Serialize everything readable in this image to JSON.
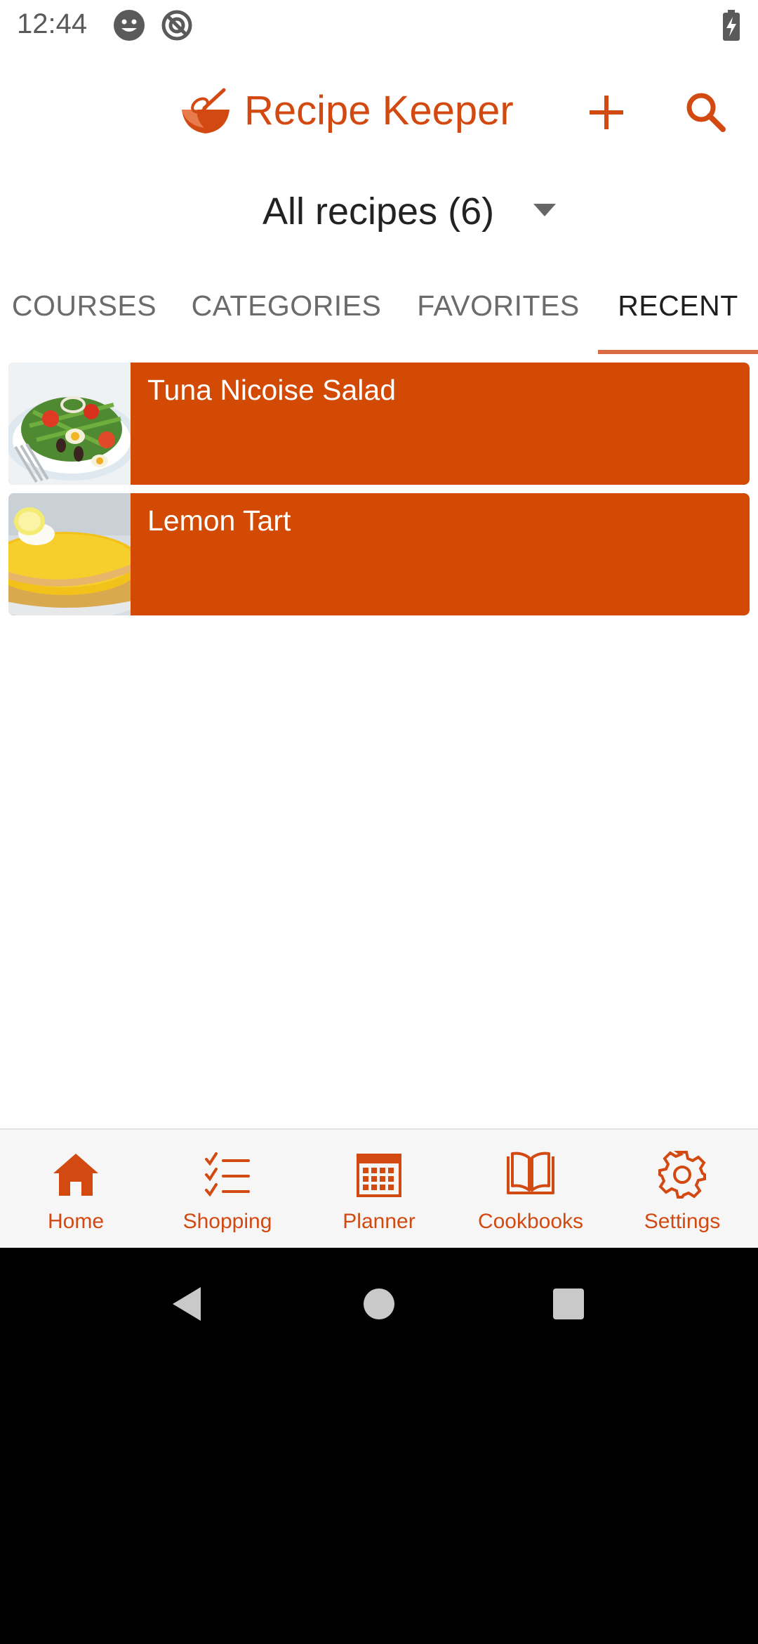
{
  "status_bar": {
    "time": "12:44"
  },
  "app_bar": {
    "title": "Recipe Keeper"
  },
  "filter": {
    "label": "All recipes (6)"
  },
  "tabs": [
    {
      "label": "COURSES"
    },
    {
      "label": "CATEGORIES"
    },
    {
      "label": "FAVORITES"
    },
    {
      "label": "RECENT",
      "active": true
    }
  ],
  "recipes": [
    {
      "name": "Tuna Nicoise Salad"
    },
    {
      "name": "Lemon Tart"
    }
  ],
  "bottom_nav": [
    {
      "label": "Home",
      "icon": "home-icon",
      "active": true
    },
    {
      "label": "Shopping",
      "icon": "checklist-icon"
    },
    {
      "label": "Planner",
      "icon": "calendar-icon"
    },
    {
      "label": "Cookbooks",
      "icon": "book-icon"
    },
    {
      "label": "Settings",
      "icon": "gear-icon"
    }
  ],
  "colors": {
    "accent": "#d24a04",
    "text_dark": "#222222",
    "tab_inactive": "#6b6b6b"
  }
}
